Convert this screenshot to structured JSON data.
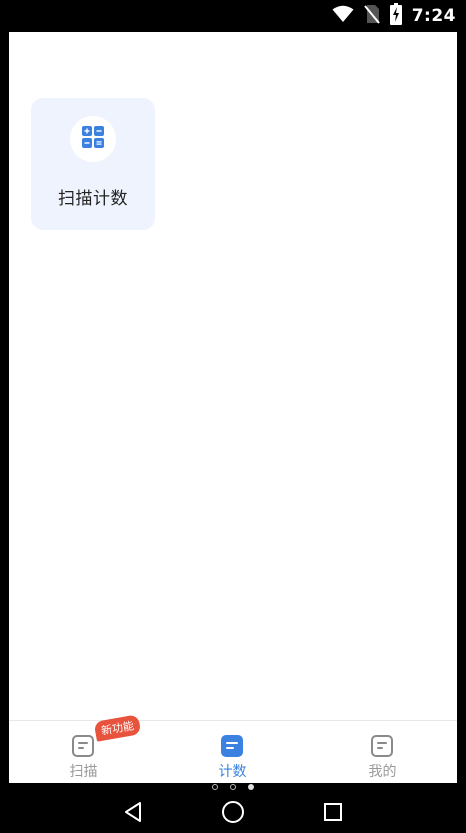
{
  "status_bar": {
    "time": "7:24",
    "icons": [
      "wifi-icon",
      "no-sim-icon",
      "battery-charging-icon"
    ]
  },
  "main": {
    "cards": [
      {
        "label": "扫描计数",
        "icon": "calculator-grid-icon"
      }
    ]
  },
  "tab_bar": {
    "tabs": [
      {
        "label": "扫描",
        "icon": "document-icon",
        "active": false,
        "badge": "新功能"
      },
      {
        "label": "计数",
        "icon": "document-icon",
        "active": true
      },
      {
        "label": "我的",
        "icon": "document-icon",
        "active": false
      }
    ]
  },
  "pager": {
    "count": 3,
    "active_index": 2
  },
  "nav_bar": {
    "buttons": [
      "back-icon",
      "home-icon",
      "recents-icon"
    ]
  },
  "colors": {
    "accent": "#3b82e0",
    "badge": "#e8533d",
    "card_background": "#eef3fd"
  }
}
